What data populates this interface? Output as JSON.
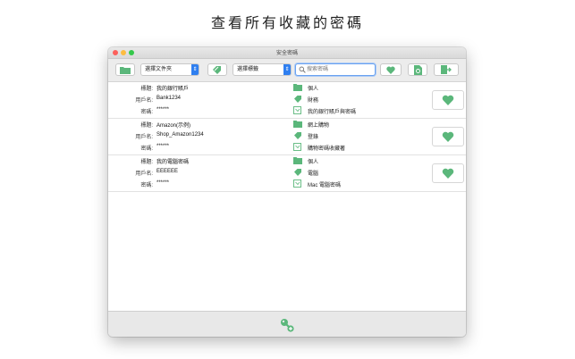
{
  "headline": "查看所有收藏的密碼",
  "window": {
    "title": "安全密碼"
  },
  "toolbar": {
    "folder_select": "選擇文件夾",
    "tag_select": "選擇標籤",
    "search_placeholder": "搜索密碼"
  },
  "entries": [
    {
      "title_label": "標題:",
      "title": "我的銀行賬戶",
      "user_label": "用戶名:",
      "user": "Bank1234",
      "pass_label": "密碼:",
      "pass": "******",
      "folder": "個人",
      "tag": "財務",
      "note": "我的銀行賬戶與密碼"
    },
    {
      "title_label": "標題:",
      "title": "Amazon(示例)",
      "user_label": "用戶名:",
      "user": "Shop_Amazon1234",
      "pass_label": "密碼:",
      "pass": "******",
      "folder": "網上購物",
      "tag": "登錄",
      "note": "購物密碼收藏著"
    },
    {
      "title_label": "標題:",
      "title": "我的電腦密碼",
      "user_label": "用戶名:",
      "user": "EEEEEE",
      "pass_label": "密碼:",
      "pass": "******",
      "folder": "個人",
      "tag": "電腦",
      "note": "Mac 電腦密碼"
    }
  ],
  "colors": {
    "accent_green": "#5bb77b",
    "select_blue": "#2f7ff0"
  },
  "icons": [
    "folder-icon",
    "tag-icon",
    "search-icon",
    "heart-icon",
    "refresh-doc-icon",
    "export-icon",
    "note-icon",
    "add-key-icon"
  ]
}
